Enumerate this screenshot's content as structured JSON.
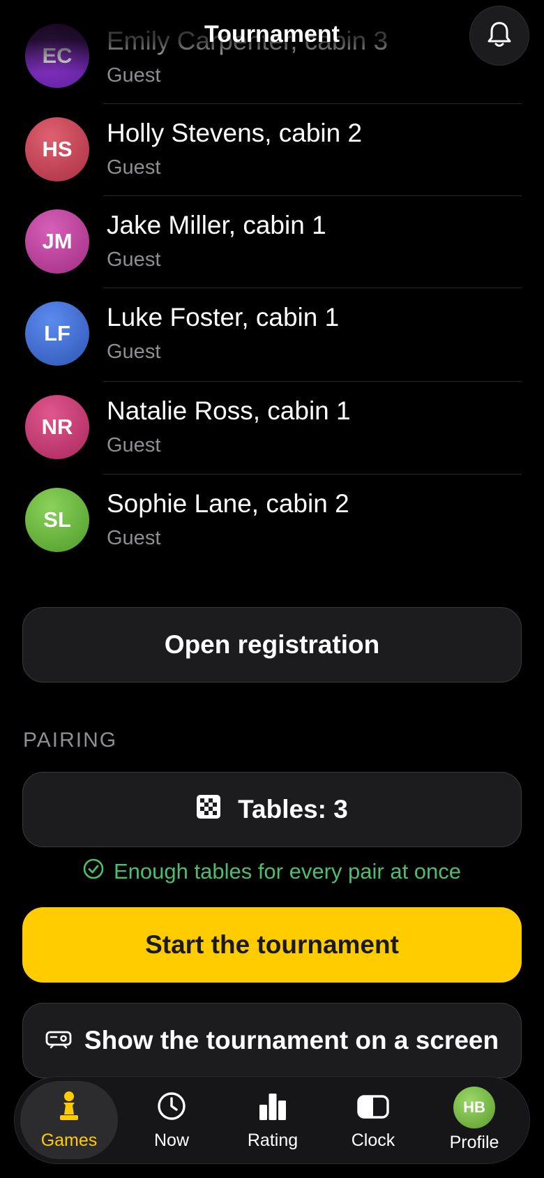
{
  "header": {
    "title": "Tournament",
    "bell_icon": "bell-icon"
  },
  "players": [
    {
      "initials": "EC",
      "name": "Emily Carpenter, cabin 3",
      "role": "Guest",
      "color_top": "#9b3fd6",
      "color_bottom": "#5a1d9a"
    },
    {
      "initials": "HS",
      "name": "Holly Stevens, cabin 2",
      "role": "Guest",
      "color_top": "#e06070",
      "color_bottom": "#a83043"
    },
    {
      "initials": "JM",
      "name": "Jake Miller, cabin 1",
      "role": "Guest",
      "color_top": "#d660b8",
      "color_bottom": "#a12c83"
    },
    {
      "initials": "LF",
      "name": "Luke Foster, cabin 1",
      "role": "Guest",
      "color_top": "#5b8bf0",
      "color_bottom": "#2f56b3"
    },
    {
      "initials": "NR",
      "name": "Natalie Ross, cabin 1",
      "role": "Guest",
      "color_top": "#e0578c",
      "color_bottom": "#a8285c"
    },
    {
      "initials": "SL",
      "name": "Sophie Lane, cabin 2",
      "role": "Guest",
      "color_top": "#8ad25a",
      "color_bottom": "#4f9a2a"
    }
  ],
  "registration": {
    "button_label": "Open registration"
  },
  "pairing": {
    "section_label": "PAIRING",
    "tables_label": "Tables: 3",
    "tables_icon": "chessboard-icon",
    "status_text": "Enough tables for every pair at once",
    "status_icon": "check-circle-icon",
    "status_color": "#4cbf6b"
  },
  "actions": {
    "start_label": "Start the tournament",
    "start_color": "#ffcc00",
    "screen_label": "Show the tournament on a screen",
    "screen_icon": "projector-icon"
  },
  "tabbar": {
    "tabs": [
      {
        "label": "Games",
        "icon": "pawn-icon",
        "active": true
      },
      {
        "label": "Now",
        "icon": "clock-icon",
        "active": false
      },
      {
        "label": "Rating",
        "icon": "bar-chart-icon",
        "active": false
      },
      {
        "label": "Clock",
        "icon": "chess-clock-icon",
        "active": false
      },
      {
        "label": "Profile",
        "icon": "avatar",
        "active": false
      }
    ],
    "profile_initials": "HB"
  }
}
